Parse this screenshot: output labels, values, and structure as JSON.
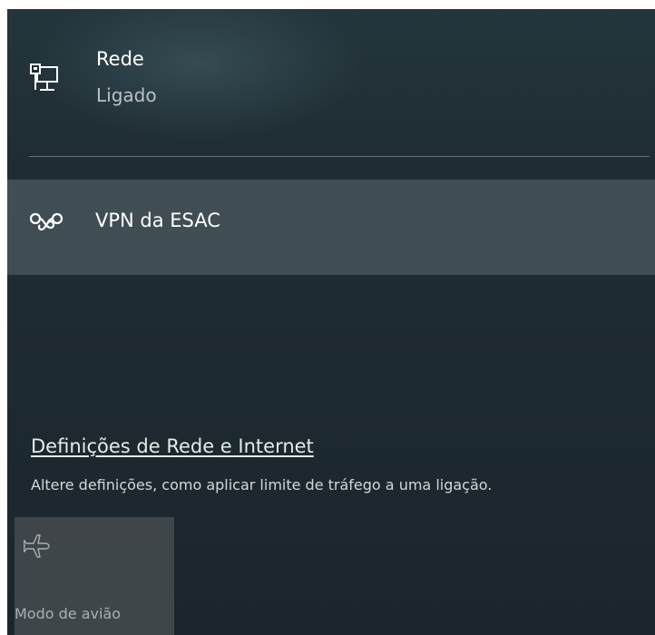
{
  "network": {
    "icon": "ethernet-pc-icon",
    "name": "Rede",
    "status": "Ligado"
  },
  "vpn": {
    "icon": "vpn-icon",
    "name": "VPN da ESAC"
  },
  "settings": {
    "link_label": "Definições de Rede e Internet",
    "description": "Altere definições, como aplicar limite de tráfego a uma ligação."
  },
  "quick_actions": [
    {
      "icon": "airplane-icon",
      "label": "Modo de avião",
      "state": "off"
    }
  ],
  "colors": {
    "panel_background": "#1f2d33",
    "vpn_highlight": "#4a575c",
    "tile_background": "#3f4649",
    "secondary_text": "#b9c2c5"
  }
}
